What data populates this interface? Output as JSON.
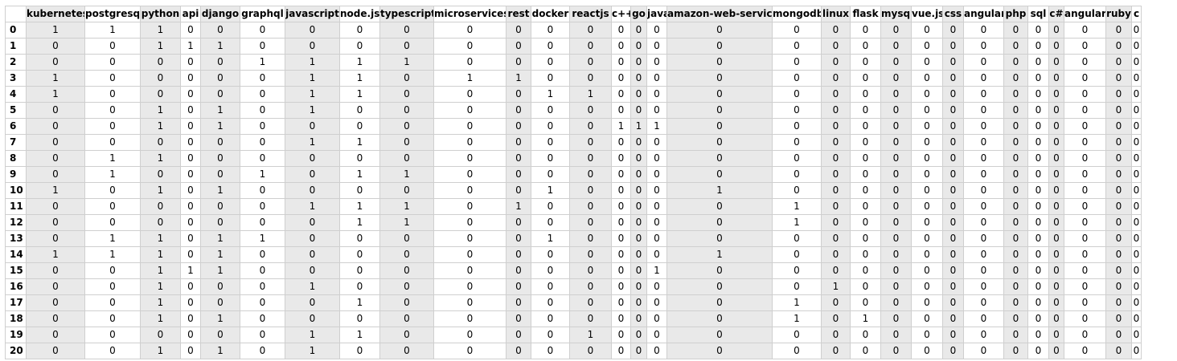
{
  "table": {
    "columns": [
      "kubernetes",
      "postgresql",
      "python",
      "api",
      "django",
      "graphql",
      "javascript",
      "node.js",
      "typescript",
      "microservices",
      "rest",
      "docker",
      "reactjs",
      "c++",
      "go",
      "java",
      "amazon-web-services",
      "mongodb",
      "linux",
      "flask",
      "mysql",
      "vue.js",
      "css",
      "angular",
      "php",
      "sql",
      "c#",
      "angularjs",
      "ruby",
      "c"
    ],
    "rows": [
      {
        "index": "0",
        "values": [
          "1",
          "1",
          "1",
          "0",
          "0",
          "0",
          "0",
          "0",
          "0",
          "0",
          "0",
          "0",
          "0",
          "0",
          "0",
          "0",
          "0",
          "0",
          "0",
          "0",
          "0",
          "0",
          "0",
          "0",
          "0",
          "0",
          "0",
          "0",
          "0",
          "0"
        ]
      },
      {
        "index": "1",
        "values": [
          "0",
          "0",
          "1",
          "1",
          "1",
          "0",
          "0",
          "0",
          "0",
          "0",
          "0",
          "0",
          "0",
          "0",
          "0",
          "0",
          "0",
          "0",
          "0",
          "0",
          "0",
          "0",
          "0",
          "0",
          "0",
          "0",
          "0",
          "0",
          "0",
          "0"
        ]
      },
      {
        "index": "2",
        "values": [
          "0",
          "0",
          "0",
          "0",
          "0",
          "1",
          "1",
          "1",
          "1",
          "0",
          "0",
          "0",
          "0",
          "0",
          "0",
          "0",
          "0",
          "0",
          "0",
          "0",
          "0",
          "0",
          "0",
          "0",
          "0",
          "0",
          "0",
          "0",
          "0",
          "0"
        ]
      },
      {
        "index": "3",
        "values": [
          "1",
          "0",
          "0",
          "0",
          "0",
          "0",
          "1",
          "1",
          "0",
          "1",
          "1",
          "0",
          "0",
          "0",
          "0",
          "0",
          "0",
          "0",
          "0",
          "0",
          "0",
          "0",
          "0",
          "0",
          "0",
          "0",
          "0",
          "0",
          "0",
          "0"
        ]
      },
      {
        "index": "4",
        "values": [
          "1",
          "0",
          "0",
          "0",
          "0",
          "0",
          "1",
          "1",
          "0",
          "0",
          "0",
          "1",
          "1",
          "0",
          "0",
          "0",
          "0",
          "0",
          "0",
          "0",
          "0",
          "0",
          "0",
          "0",
          "0",
          "0",
          "0",
          "0",
          "0",
          "0"
        ]
      },
      {
        "index": "5",
        "values": [
          "0",
          "0",
          "1",
          "0",
          "1",
          "0",
          "1",
          "0",
          "0",
          "0",
          "0",
          "0",
          "0",
          "0",
          "0",
          "0",
          "0",
          "0",
          "0",
          "0",
          "0",
          "0",
          "0",
          "0",
          "0",
          "0",
          "0",
          "0",
          "0",
          "0"
        ]
      },
      {
        "index": "6",
        "values": [
          "0",
          "0",
          "1",
          "0",
          "1",
          "0",
          "0",
          "0",
          "0",
          "0",
          "0",
          "0",
          "0",
          "1",
          "1",
          "1",
          "0",
          "0",
          "0",
          "0",
          "0",
          "0",
          "0",
          "0",
          "0",
          "0",
          "0",
          "0",
          "0",
          "0"
        ]
      },
      {
        "index": "7",
        "values": [
          "0",
          "0",
          "0",
          "0",
          "0",
          "0",
          "1",
          "1",
          "0",
          "0",
          "0",
          "0",
          "0",
          "0",
          "0",
          "0",
          "0",
          "0",
          "0",
          "0",
          "0",
          "0",
          "0",
          "0",
          "0",
          "0",
          "0",
          "0",
          "0",
          "0"
        ]
      },
      {
        "index": "8",
        "values": [
          "0",
          "1",
          "1",
          "0",
          "0",
          "0",
          "0",
          "0",
          "0",
          "0",
          "0",
          "0",
          "0",
          "0",
          "0",
          "0",
          "0",
          "0",
          "0",
          "0",
          "0",
          "0",
          "0",
          "0",
          "0",
          "0",
          "0",
          "0",
          "0",
          "0"
        ]
      },
      {
        "index": "9",
        "values": [
          "0",
          "1",
          "0",
          "0",
          "0",
          "1",
          "0",
          "1",
          "1",
          "0",
          "0",
          "0",
          "0",
          "0",
          "0",
          "0",
          "0",
          "0",
          "0",
          "0",
          "0",
          "0",
          "0",
          "0",
          "0",
          "0",
          "0",
          "0",
          "0",
          "0"
        ]
      },
      {
        "index": "10",
        "values": [
          "1",
          "0",
          "1",
          "0",
          "1",
          "0",
          "0",
          "0",
          "0",
          "0",
          "0",
          "1",
          "0",
          "0",
          "0",
          "0",
          "1",
          "0",
          "0",
          "0",
          "0",
          "0",
          "0",
          "0",
          "0",
          "0",
          "0",
          "0",
          "0",
          "0"
        ]
      },
      {
        "index": "11",
        "values": [
          "0",
          "0",
          "0",
          "0",
          "0",
          "0",
          "1",
          "1",
          "1",
          "0",
          "1",
          "0",
          "0",
          "0",
          "0",
          "0",
          "0",
          "1",
          "0",
          "0",
          "0",
          "0",
          "0",
          "0",
          "0",
          "0",
          "0",
          "0",
          "0",
          "0"
        ]
      },
      {
        "index": "12",
        "values": [
          "0",
          "0",
          "0",
          "0",
          "0",
          "0",
          "0",
          "1",
          "1",
          "0",
          "0",
          "0",
          "0",
          "0",
          "0",
          "0",
          "0",
          "1",
          "0",
          "0",
          "0",
          "0",
          "0",
          "0",
          "0",
          "0",
          "0",
          "0",
          "0",
          "0"
        ]
      },
      {
        "index": "13",
        "values": [
          "0",
          "1",
          "1",
          "0",
          "1",
          "1",
          "0",
          "0",
          "0",
          "0",
          "0",
          "1",
          "0",
          "0",
          "0",
          "0",
          "0",
          "0",
          "0",
          "0",
          "0",
          "0",
          "0",
          "0",
          "0",
          "0",
          "0",
          "0",
          "0",
          "0"
        ]
      },
      {
        "index": "14",
        "values": [
          "1",
          "1",
          "1",
          "0",
          "1",
          "0",
          "0",
          "0",
          "0",
          "0",
          "0",
          "0",
          "0",
          "0",
          "0",
          "0",
          "1",
          "0",
          "0",
          "0",
          "0",
          "0",
          "0",
          "0",
          "0",
          "0",
          "0",
          "0",
          "0",
          "0"
        ]
      },
      {
        "index": "15",
        "values": [
          "0",
          "0",
          "1",
          "1",
          "1",
          "0",
          "0",
          "0",
          "0",
          "0",
          "0",
          "0",
          "0",
          "0",
          "0",
          "1",
          "0",
          "0",
          "0",
          "0",
          "0",
          "0",
          "0",
          "0",
          "0",
          "0",
          "0",
          "0",
          "0",
          "0"
        ]
      },
      {
        "index": "16",
        "values": [
          "0",
          "0",
          "1",
          "0",
          "0",
          "0",
          "1",
          "0",
          "0",
          "0",
          "0",
          "0",
          "0",
          "0",
          "0",
          "0",
          "0",
          "0",
          "1",
          "0",
          "0",
          "0",
          "0",
          "0",
          "0",
          "0",
          "0",
          "0",
          "0",
          "0"
        ]
      },
      {
        "index": "17",
        "values": [
          "0",
          "0",
          "1",
          "0",
          "0",
          "0",
          "0",
          "1",
          "0",
          "0",
          "0",
          "0",
          "0",
          "0",
          "0",
          "0",
          "0",
          "1",
          "0",
          "0",
          "0",
          "0",
          "0",
          "0",
          "0",
          "0",
          "0",
          "0",
          "0",
          "0"
        ]
      },
      {
        "index": "18",
        "values": [
          "0",
          "0",
          "1",
          "0",
          "1",
          "0",
          "0",
          "0",
          "0",
          "0",
          "0",
          "0",
          "0",
          "0",
          "0",
          "0",
          "0",
          "1",
          "0",
          "1",
          "0",
          "0",
          "0",
          "0",
          "0",
          "0",
          "0",
          "0",
          "0",
          "0"
        ]
      },
      {
        "index": "19",
        "values": [
          "0",
          "0",
          "0",
          "0",
          "0",
          "0",
          "1",
          "1",
          "0",
          "0",
          "0",
          "0",
          "1",
          "0",
          "0",
          "0",
          "0",
          "0",
          "0",
          "0",
          "0",
          "0",
          "0",
          "0",
          "0",
          "0",
          "0",
          "0",
          "0",
          "0"
        ]
      },
      {
        "index": "20",
        "values": [
          "0",
          "0",
          "1",
          "0",
          "1",
          "0",
          "1",
          "0",
          "0",
          "0",
          "0",
          "0",
          "0",
          "0",
          "0",
          "0",
          "0",
          "0",
          "0",
          "0",
          "0",
          "0",
          "0",
          "0",
          "0",
          "0",
          "0",
          "0",
          "0",
          "0"
        ]
      }
    ]
  }
}
